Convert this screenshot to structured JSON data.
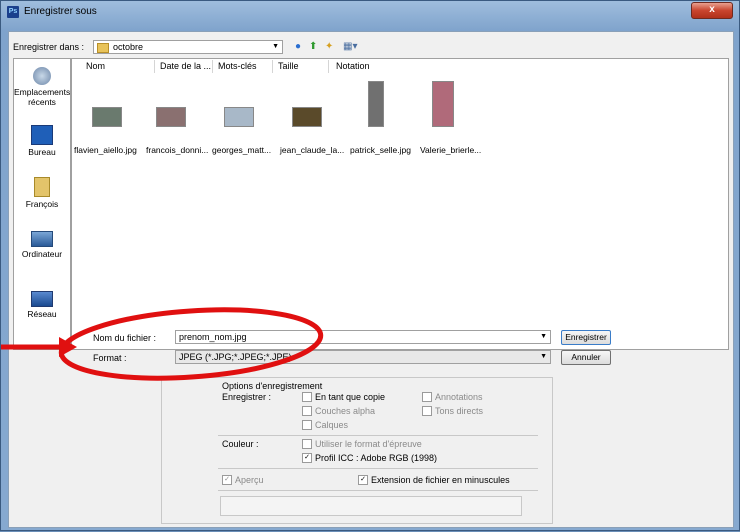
{
  "window": {
    "title": "Enregistrer sous",
    "app_icon": "Ps",
    "close_label": "x"
  },
  "toolbar": {
    "save_in_label": "Enregistrer dans :",
    "folder": "octobre"
  },
  "places": [
    {
      "label": "Emplacements récents",
      "icon": "recent-places-icon"
    },
    {
      "label": "Bureau",
      "icon": "desktop-icon"
    },
    {
      "label": "François",
      "icon": "user-folder-icon"
    },
    {
      "label": "Ordinateur",
      "icon": "computer-icon"
    },
    {
      "label": "Réseau",
      "icon": "network-icon"
    }
  ],
  "columns": [
    "Nom",
    "Date de la ...",
    "Mots-clés",
    "Taille",
    "Notation"
  ],
  "files": [
    {
      "name": "flavien_aiello.jpg",
      "color": "#6a7a6e"
    },
    {
      "name": "francois_donni...",
      "color": "#8a7070"
    },
    {
      "name": "georges_matt...",
      "color": "#a8b8c8"
    },
    {
      "name": "jean_claude_la...",
      "color": "#5a4a2a"
    },
    {
      "name": "patrick_selle.jpg",
      "color": "#707070"
    },
    {
      "name": "Valerie_brierle...",
      "color": "#b06a7a"
    }
  ],
  "filename": {
    "label": "Nom du fichier :",
    "value": "prenom_nom.jpg"
  },
  "format": {
    "label": "Format :",
    "value": "JPEG (*.JPG;*.JPEG;*.JPE)"
  },
  "buttons": {
    "save": "Enregistrer",
    "cancel": "Annuler"
  },
  "options": {
    "title": "Options d'enregistrement",
    "save_label": "Enregistrer :",
    "as_copy": "En tant que copie",
    "annotations": "Annotations",
    "alpha": "Couches alpha",
    "spot": "Tons directs",
    "layers": "Calques",
    "color_label": "Couleur :",
    "proof": "Utiliser le format d'épreuve",
    "icc": "Profil ICC : Adobe RGB (1998)",
    "thumbnail": "Aperçu",
    "lowercase": "Extension de fichier en minuscules"
  },
  "colors": {
    "annotation_red": "#e01010"
  }
}
